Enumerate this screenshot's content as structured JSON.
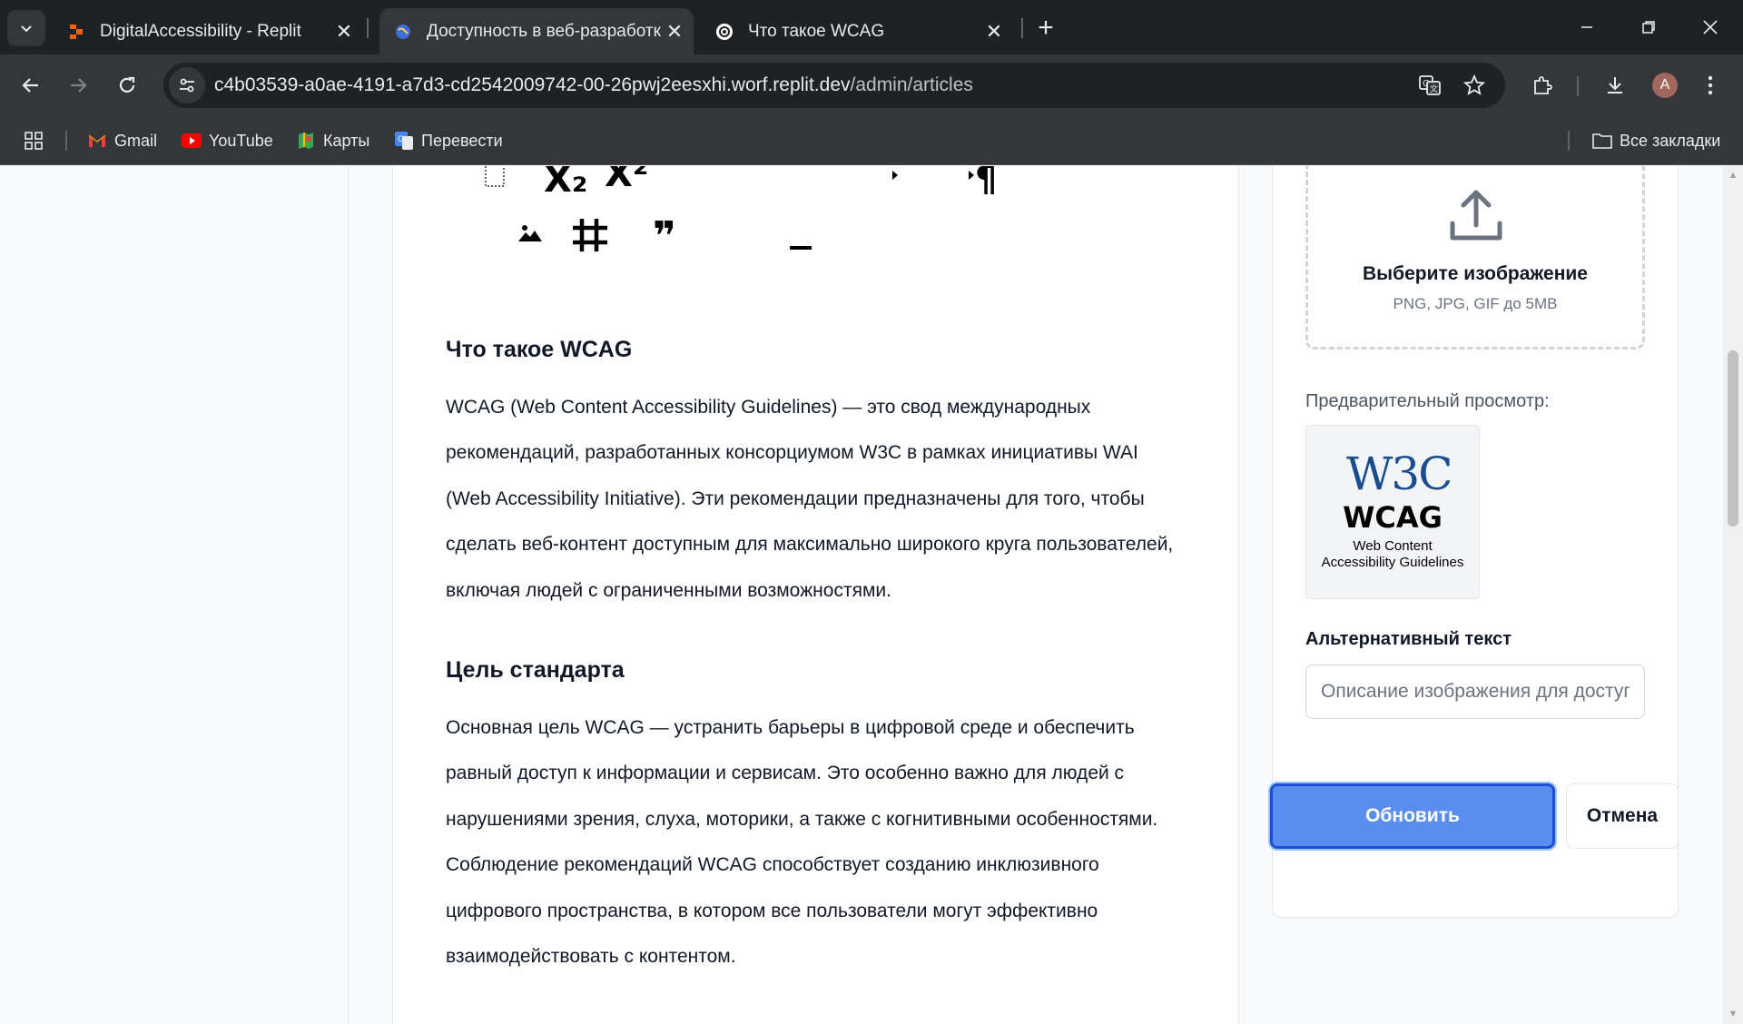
{
  "browser": {
    "tabs": [
      {
        "title": "DigitalAccessibility - Replit",
        "favicon": "replit-icon",
        "active": false
      },
      {
        "title": "Доступность в веб-разработке",
        "favicon": "globe-icon",
        "active": true
      },
      {
        "title": "Что такое WCAG",
        "favicon": "openai-icon",
        "active": false
      }
    ],
    "url_host": "c4b03539-a0ae-4191-a7d3-cd2542009742-00-26pwj2eesxhi.worf.replit.dev",
    "url_path": "/admin/articles",
    "profile_initial": "A",
    "bookmarks": [
      {
        "label": "Gmail",
        "icon": "gmail-icon"
      },
      {
        "label": "YouTube",
        "icon": "youtube-icon"
      },
      {
        "label": "Карты",
        "icon": "maps-icon"
      },
      {
        "label": "Перевести",
        "icon": "translate-icon"
      }
    ],
    "all_bookmarks": "Все закладки"
  },
  "editor": {
    "toolbar_glyphs": {
      "subscript": "X₂",
      "superscript": "X²",
      "pilcrow": "¶",
      "quote": "❞",
      "image": "image-icon",
      "table": "table-icon",
      "hr": "hr-icon"
    },
    "sections": [
      {
        "heading": "Что такое WCAG",
        "lines": [
          "WCAG (Web Content Accessibility Guidelines) — это свод международных",
          "рекомендаций, разработанных консорциумом W3C в рамках инициативы WAI",
          "(Web Accessibility Initiative). Эти рекомендации предназначены для того, чтобы",
          "сделать веб-контент доступным для максимально широкого круга пользователей,",
          "включая людей с ограниченными возможностями."
        ]
      },
      {
        "heading": "Цель стандарта",
        "lines": [
          "Основная цель WCAG — устранить барьеры в цифровой среде и обеспечить",
          "равный доступ к информации и сервисам. Это особенно важно для людей с",
          "нарушениями зрения, слуха, моторики, а также с когнитивными особенностями.",
          "Соблюдение рекомендаций WCAG способствует созданию инклюзивного",
          "цифрового пространства, в котором все пользователи могут эффективно",
          "взаимодействовать с контентом."
        ]
      }
    ]
  },
  "sidebar": {
    "upload_title": "Выберите изображение",
    "upload_hint": "PNG, JPG, GIF до 5MB",
    "preview_label": "Предварительный просмотр:",
    "preview": {
      "logo_w3c": "W3C",
      "logo_wcag": "WCAG",
      "logo_line1": "Web Content",
      "logo_line2": "Accessibility Guidelines"
    },
    "alt_label": "Альтернативный текст",
    "alt_placeholder": "Описание изображения для доступности",
    "update_label": "Обновить",
    "cancel_label": "Отмена"
  },
  "colors": {
    "primary_button": "#5b8def",
    "focus_ring": "#1d4ed8"
  }
}
